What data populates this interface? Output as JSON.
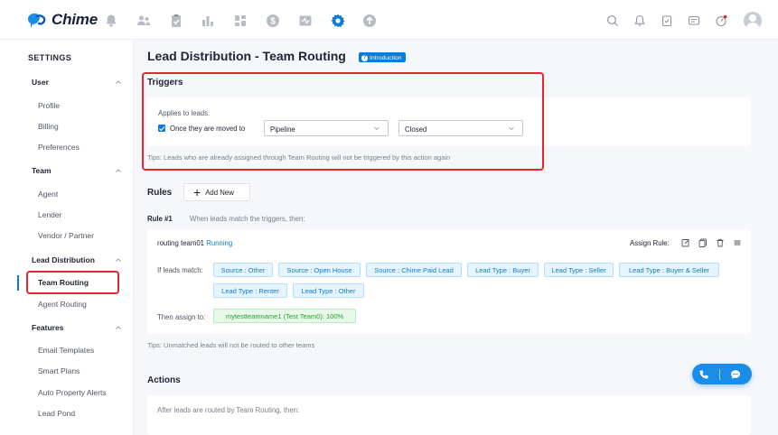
{
  "app": {
    "name": "Chime"
  },
  "topnav": {
    "icons": [
      "bell-badge-icon",
      "people-icon",
      "clipboard-icon",
      "bar-chart-icon",
      "dashboard-icon",
      "dollar-icon",
      "activity-icon",
      "gear-icon",
      "upload-icon"
    ],
    "active_icon": "gear-icon",
    "right_icons": [
      "search-icon",
      "notification-icon",
      "task-icon",
      "message-icon",
      "gauge-icon",
      "avatar"
    ]
  },
  "sidebar": {
    "title": "SETTINGS",
    "groups": [
      {
        "label": "User",
        "items": [
          "Profile",
          "Billing",
          "Preferences"
        ]
      },
      {
        "label": "Team",
        "items": [
          "Agent",
          "Lender",
          "Vendor / Partner"
        ]
      },
      {
        "label": "Lead Distribution",
        "items": [
          "Team Routing",
          "Agent Routing"
        ]
      },
      {
        "label": "Features",
        "items": [
          "Email Templates",
          "Smart Plans",
          "Auto Property Alerts",
          "Lead Pond"
        ]
      }
    ],
    "active_item": "Team Routing"
  },
  "page": {
    "title": "Lead Distribution - Team Routing",
    "intro_badge": "Introduction"
  },
  "triggers": {
    "title": "Triggers",
    "applies_label": "Applies to leads:",
    "checkbox_label": "Once they are moved to",
    "checkbox_checked": true,
    "select1_value": "Pipeline",
    "select2_value": "Closed",
    "tips": "Tips: Leads who are already assigned through Team Routing will not be triggered by this action again"
  },
  "rules": {
    "title": "Rules",
    "add_new": "Add New",
    "rule_label": "Rule #1",
    "rule_desc": "When leads match the triggers, then:",
    "team_name": "routing team01",
    "status": "Running",
    "assign_rule_label": "Assign Rule:",
    "match_label": "If leads match:",
    "tags": [
      "Source : Other",
      "Source : Open House",
      "Source : Chime Paid Lead",
      "Lead Type : Buyer",
      "Lead Type : Seller",
      "Lead Type : Buyer & Seller",
      "Lead Type : Renter",
      "Lead Type : Other"
    ],
    "assign_label": "Then assign to:",
    "assignee": "mytestteamname1 (Test Team0): 100%",
    "tips": "Tips: Unmatched leads will not be routed to other teams"
  },
  "actions": {
    "title": "Actions",
    "desc": "After leads are routed by Team Routing, then:"
  },
  "colors": {
    "accent": "#0a7dd8",
    "highlight": "#e3262f",
    "success": "#22a22f"
  }
}
